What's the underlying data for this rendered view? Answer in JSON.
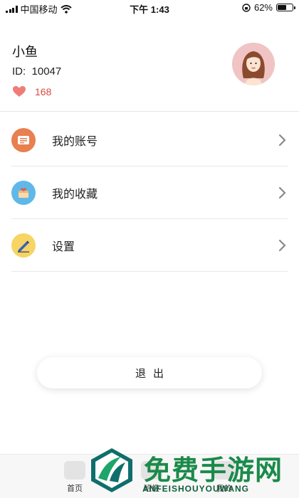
{
  "status_bar": {
    "carrier": "中国移动",
    "time": "下午 1:43",
    "battery": "62%",
    "battery_level": 0.62
  },
  "profile": {
    "name": "小鱼",
    "id_label": "ID:",
    "id_value": "10047",
    "likes": "168"
  },
  "menu": [
    {
      "label": "我的账号",
      "icon": "account-icon",
      "color": "#e8804f"
    },
    {
      "label": "我的收藏",
      "icon": "favorites-icon",
      "color": "#5fb8e8"
    },
    {
      "label": "设置",
      "icon": "settings-pencil-icon",
      "color": "#f7d463"
    }
  ],
  "logout_label": "退出",
  "tabs": [
    {
      "label": "首页",
      "icon": "home-icon"
    },
    {
      "label": "班级",
      "icon": "class-icon"
    },
    {
      "label": "我的",
      "icon": "profile-icon"
    }
  ],
  "watermark": {
    "text": "免费手游网",
    "subtext": "ANFEISHOUYOUWANG",
    "color": "#1a8a4a"
  }
}
